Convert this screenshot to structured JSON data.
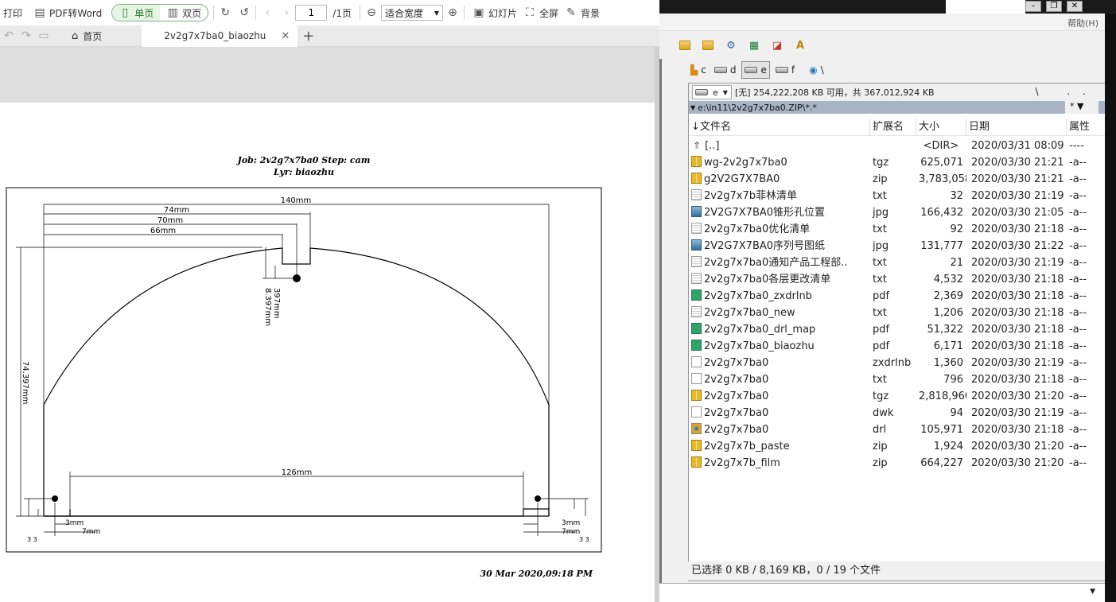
{
  "pdf_viewer": {
    "toolbar": {
      "print": "打印",
      "pdf_to_word": "PDF转Word",
      "single_page": "单页",
      "double_page": "双页",
      "page_input": "1",
      "page_total": "/1页",
      "zoom": "适合宽度",
      "slideshow": "幻灯片",
      "fullscreen": "全屏",
      "background": "背景"
    },
    "tabs": {
      "home": "首页",
      "document": "2v2g7x7ba0_biaozhu"
    },
    "drawing": {
      "header_line1": "Job: 2v2g7x7ba0  Step: cam",
      "header_line2": "Lyr: biaozhu",
      "dim_140": "140mm",
      "dim_74": "74mm",
      "dim_70": "70mm",
      "dim_66": "66mm",
      "dim_126": "126mm",
      "dim_height": "74.397mm",
      "dim_397": "397mm",
      "dim_8397": "8.397mm",
      "dim_3mm": "3mm",
      "dim_7mm": "7mm",
      "dim_small": "3 3",
      "footer_date": "30 Mar 2020,09:18 PM"
    }
  },
  "file_manager": {
    "menu": {
      "help": "帮助(H)"
    },
    "drives": [
      "c",
      "d",
      "e",
      "f",
      "\\"
    ],
    "active_drive": "e",
    "drive_select": "e",
    "free_space": "[无]  254,222,208 KB 可用，共 367,012,924 KB",
    "drivebar_right": "\\ ..",
    "path": "e:\\in11\\2v2g7x7ba0.ZIP\\*.*",
    "filter": "* ▼",
    "columns": {
      "name": "文件名",
      "ext": "扩展名",
      "size": "大小",
      "date": "日期",
      "attr": "属性"
    },
    "files": [
      {
        "icon": "folder-up",
        "name": "[..]",
        "ext": "",
        "size": "<DIR>",
        "date": "2020/03/31 08:09",
        "attr": "----"
      },
      {
        "icon": "archive",
        "name": "wg-2v2g7x7ba0",
        "ext": "tgz",
        "size": "625,071",
        "date": "2020/03/30 21:21",
        "attr": "-a--"
      },
      {
        "icon": "archive",
        "name": "g2V2G7X7BA0",
        "ext": "zip",
        "size": "3,783,058",
        "date": "2020/03/30 21:21",
        "attr": "-a--"
      },
      {
        "icon": "txt",
        "name": "2v2g7x7b菲林清单",
        "ext": "txt",
        "size": "32",
        "date": "2020/03/30 21:19",
        "attr": "-a--"
      },
      {
        "icon": "image",
        "name": "2V2G7X7BA0锥形孔位置",
        "ext": "jpg",
        "size": "166,432",
        "date": "2020/03/30 21:05",
        "attr": "-a--"
      },
      {
        "icon": "txt",
        "name": "2v2g7x7ba0优化清单",
        "ext": "txt",
        "size": "92",
        "date": "2020/03/30 21:18",
        "attr": "-a--"
      },
      {
        "icon": "image",
        "name": "2V2G7X7BA0序列号图纸",
        "ext": "jpg",
        "size": "131,777",
        "date": "2020/03/30 21:22",
        "attr": "-a--"
      },
      {
        "icon": "txt",
        "name": "2v2g7x7ba0通知产品工程部..",
        "ext": "txt",
        "size": "21",
        "date": "2020/03/30 21:19",
        "attr": "-a--"
      },
      {
        "icon": "txt",
        "name": "2v2g7x7ba0各层更改清单",
        "ext": "txt",
        "size": "4,532",
        "date": "2020/03/30 21:18",
        "attr": "-a--"
      },
      {
        "icon": "pdf",
        "name": "2v2g7x7ba0_zxdrlnb",
        "ext": "pdf",
        "size": "2,369",
        "date": "2020/03/30 21:18",
        "attr": "-a--"
      },
      {
        "icon": "txt",
        "name": "2v2g7x7ba0_new",
        "ext": "txt",
        "size": "1,206",
        "date": "2020/03/30 21:18",
        "attr": "-a--"
      },
      {
        "icon": "pdf",
        "name": "2v2g7x7ba0_drl_map",
        "ext": "pdf",
        "size": "51,322",
        "date": "2020/03/30 21:18",
        "attr": "-a--"
      },
      {
        "icon": "pdf",
        "name": "2v2g7x7ba0_biaozhu",
        "ext": "pdf",
        "size": "6,171",
        "date": "2020/03/30 21:18",
        "attr": "-a--"
      },
      {
        "icon": "blank",
        "name": "2v2g7x7ba0",
        "ext": "zxdrlnb",
        "size": "1,360",
        "date": "2020/03/30 21:19",
        "attr": "-a--"
      },
      {
        "icon": "blank",
        "name": "2v2g7x7ba0",
        "ext": "txt",
        "size": "796",
        "date": "2020/03/30 21:18",
        "attr": "-a--"
      },
      {
        "icon": "archive",
        "name": "2v2g7x7ba0",
        "ext": "tgz",
        "size": "2,818,960",
        "date": "2020/03/30 21:20",
        "attr": "-a--"
      },
      {
        "icon": "blank",
        "name": "2v2g7x7ba0",
        "ext": "dwk",
        "size": "94",
        "date": "2020/03/30 21:19",
        "attr": "-a--"
      },
      {
        "icon": "drl",
        "name": "2v2g7x7ba0",
        "ext": "drl",
        "size": "105,971",
        "date": "2020/03/30 21:18",
        "attr": "-a--"
      },
      {
        "icon": "archive",
        "name": "2v2g7x7b_paste",
        "ext": "zip",
        "size": "1,924",
        "date": "2020/03/30 21:20",
        "attr": "-a--"
      },
      {
        "icon": "archive",
        "name": "2v2g7x7b_film",
        "ext": "zip",
        "size": "664,227",
        "date": "2020/03/30 21:20",
        "attr": "-a--"
      }
    ],
    "status": "已选择 0 KB / 8,169 KB，0 / 19 个文件"
  }
}
